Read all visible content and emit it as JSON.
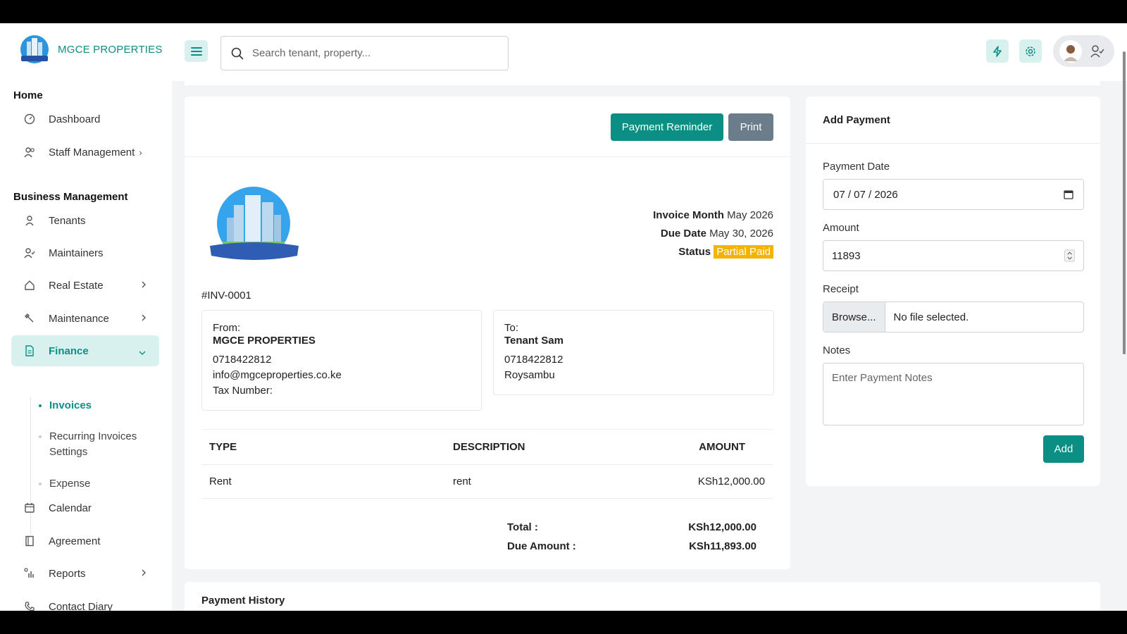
{
  "brand": {
    "name": "MGCE PROPERTIES",
    "logo_text": "MGCE PROPERTIES"
  },
  "search": {
    "placeholder": "Search tenant, property..."
  },
  "sidebar": {
    "sections": [
      "Home",
      "Business Management"
    ],
    "items": [
      {
        "label": "Dashboard",
        "icon": "dashboard-icon"
      },
      {
        "label": "Staff Management",
        "icon": "users-icon"
      },
      {
        "label": "Tenants",
        "icon": "user-icon"
      },
      {
        "label": "Maintainers",
        "icon": "user-check-icon"
      },
      {
        "label": "Real Estate",
        "icon": "home-icon"
      },
      {
        "label": "Maintenance",
        "icon": "wrench-icon"
      },
      {
        "label": "Finance",
        "icon": "file-icon"
      },
      {
        "label": "Calendar",
        "icon": "calendar-icon"
      },
      {
        "label": "Agreement",
        "icon": "book-icon"
      },
      {
        "label": "Reports",
        "icon": "bar-chart-icon"
      },
      {
        "label": "Contact Diary",
        "icon": "phone-icon"
      }
    ],
    "finance_sub": [
      {
        "label": "Invoices"
      },
      {
        "label": "Recurring Invoices Settings"
      },
      {
        "label": "Expense"
      }
    ]
  },
  "invoice": {
    "buttons": {
      "reminder": "Payment Reminder",
      "print": "Print"
    },
    "meta": {
      "month_label": "Invoice Month",
      "month_value": "May 2026",
      "due_label": "Due Date",
      "due_value": "May 30, 2026",
      "status_label": "Status",
      "status_value": "Partial Paid"
    },
    "number": "#INV-0001",
    "from": {
      "label": "From:",
      "name": "MGCE PROPERTIES",
      "phone": "0718422812",
      "email": "info@mgceproperties.co.ke",
      "tax": "Tax Number:"
    },
    "to": {
      "label": "To:",
      "name": "Tenant Sam",
      "phone": "0718422812",
      "address": "Roysambu"
    },
    "table": {
      "headers": [
        "TYPE",
        "DESCRIPTION",
        "AMOUNT"
      ],
      "rows": [
        {
          "type": "Rent",
          "description": "rent",
          "amount": "KSh12,000.00"
        }
      ]
    },
    "totals": {
      "total_label": "Total :",
      "total_value": "KSh12,000.00",
      "due_label": "Due Amount :",
      "due_value": "KSh11,893.00"
    }
  },
  "payment": {
    "title": "Add Payment",
    "date_label": "Payment Date",
    "date_value": "07 / 07 / 2026",
    "amount_label": "Amount",
    "amount_value": "11893",
    "receipt_label": "Receipt",
    "browse_label": "Browse...",
    "file_status": "No file selected.",
    "notes_label": "Notes",
    "notes_placeholder": "Enter Payment Notes",
    "add_label": "Add"
  },
  "history": {
    "title": "Payment History"
  },
  "colors": {
    "accent": "#0b8f84",
    "accent_light": "#d8f1ee",
    "status": "#f5b300",
    "secondary": "#6b7d8a"
  }
}
